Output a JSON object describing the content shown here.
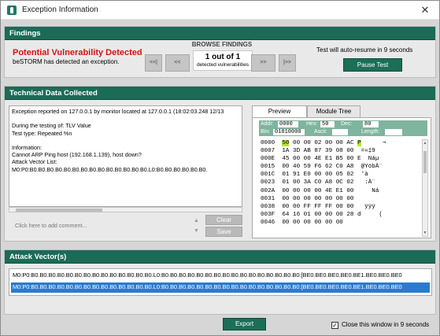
{
  "window": {
    "title": "Exception Information",
    "close_glyph": "✕",
    "icon": "app-icon"
  },
  "findings": {
    "header": "Findings",
    "vuln_title": "Potential Vulnerability Detected",
    "vuln_sub": "beSTORM has detected an exception.",
    "browse_title": "BROWSE FINDINGS",
    "first_label": "<<|",
    "prev_label": "<<",
    "next_label": ">>",
    "last_label": "|>>",
    "count_main": "1 out of 1",
    "count_sub": "detected vulnerabilities",
    "resume_text": "Test will auto-resume in 9 seconds",
    "pause_label": "Pause Test"
  },
  "tech": {
    "header": "Technical Data Collected",
    "details": "Exception reported on 127.0.0.1 by monitor located at 127.0.0.1 (18:02:03.248 12/13\n\nDuring the testing of: TLV Value\nTest type: Repeated %n\n\nInformation:\nCannot ARP Ping host (192.168.1.139), host down?\nAttack Vector List:\nM0:P0:B0.B0.B0.B0.B0.B0.B0.B0.B0.B0.B0.B0.B0.B0.L0:B0.B0.B0.B0.B0.B0.",
    "comment_placeholder": "Click here to add comment...",
    "up_glyph": "▲",
    "down_glyph": "▼",
    "clear_label": "Clear",
    "save_label": "Save",
    "tab_preview": "Preview",
    "tab_module_tree": "Module Tree",
    "hex": {
      "addr_label": "Addr:",
      "addr_value": "0000",
      "hex_label": "Hex:",
      "hex_value": "50",
      "dec_label": "Dec:",
      "dec_value": "80",
      "bin_label": "Bin:",
      "bin_value": "01010000",
      "ascii_label": "Ascii:",
      "ascii_value": "",
      "length_label": "Length:",
      "length_value": "",
      "rows": [
        {
          "addr": "0000",
          "pre": "",
          "sel": "50",
          "bytes": " 00 00 02 00 00 AC ",
          "ascii_sel": "P",
          "ascii": "      ¬"
        },
        {
          "addr": "0007",
          "pre": "",
          "sel": "",
          "bytes": "1A 3D AB 87 39 08 00 ",
          "ascii_sel": "",
          "ascii": " =«‡9"
        },
        {
          "addr": "000E",
          "pre": "",
          "sel": "",
          "bytes": "45 00 00 4E E1 B5 00 ",
          "ascii_sel": "",
          "ascii": "E  Náµ"
        },
        {
          "addr": "0015",
          "pre": "",
          "sel": "",
          "bytes": "00 40 59 F6 62 C0 A8 ",
          "ascii_sel": "",
          "ascii": " @YöbÀ¨"
        },
        {
          "addr": "001C",
          "pre": "",
          "sel": "",
          "bytes": "01 91 E0 00 00 05 02 ",
          "ascii_sel": "",
          "ascii": " 'à"
        },
        {
          "addr": "0023",
          "pre": "",
          "sel": "",
          "bytes": "01 00 3A C0 A8 0C 02 ",
          "ascii_sel": "",
          "ascii": "  :À¨"
        },
        {
          "addr": "002A",
          "pre": "",
          "sel": "",
          "bytes": "00 00 00 00 4E E1 00 ",
          "ascii_sel": "",
          "ascii": "    Ná"
        },
        {
          "addr": "0031",
          "pre": "",
          "sel": "",
          "bytes": "00 00 00 00 00 00 00 ",
          "ascii_sel": "",
          "ascii": ""
        },
        {
          "addr": "0038",
          "pre": "",
          "sel": "",
          "bytes": "00 00 FF FF FF 00 00 ",
          "ascii_sel": "",
          "ascii": "  ÿÿÿ"
        },
        {
          "addr": "003F",
          "pre": "",
          "sel": "",
          "bytes": "64 16 01 00 00 00 28 ",
          "ascii_sel": "",
          "ascii": "d     ("
        },
        {
          "addr": "0046",
          "pre": "",
          "sel": "",
          "bytes": "00 00 00 00 00 00 ",
          "ascii_sel": "",
          "ascii": ""
        }
      ]
    }
  },
  "attack": {
    "header": "Attack Vector(s)",
    "vectors": [
      "M0:P0:B0.B0.B0.B0.B0.B0.B0.B0.B0.B0.B0.B0.B0.B0.L0:B0.B0.B0.B0.B0.B0.B0.B0.B0.B0.B0.B0.B0.B0.B0.B0:[BE0.BE0.BE0.BE0.BE1.BE0.BE0.BE0",
      "M0:P0:B0.B0.B0.B0.B0.B0.B0.B0.B0.B0.B0.B0.B0.B0.L0:B0.B0.B0.B0.B0.B0.B0.B0.B0.B0.B0.B0.B0.B0.B0.B0:[BE0.BE0.BE0.BE0.BE1.BE0.BE0.BE0"
    ]
  },
  "footer": {
    "export_label": "Export",
    "checkbox_checked": true,
    "checkbox_glyph": "✓",
    "close_label": "Close this window in 9 seconds"
  },
  "colors": {
    "accent_green": "#1b6b57",
    "alert_red": "#d21414",
    "selection_blue": "#2a7bd0",
    "hex_highlight": "#b7e33a"
  }
}
